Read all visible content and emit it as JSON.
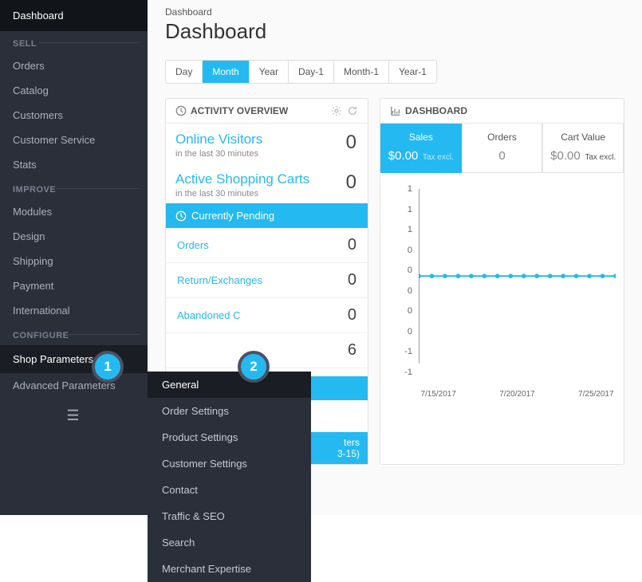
{
  "sidebar": {
    "active": "Dashboard",
    "sections": [
      {
        "label": "SELL",
        "items": [
          "Orders",
          "Catalog",
          "Customers",
          "Customer Service",
          "Stats"
        ]
      },
      {
        "label": "IMPROVE",
        "items": [
          "Modules",
          "Design",
          "Shipping",
          "Payment",
          "International"
        ]
      },
      {
        "label": "CONFIGURE",
        "items": [
          "Shop Parameters",
          "Advanced Parameters"
        ]
      }
    ]
  },
  "submenu": {
    "items": [
      "General",
      "Order Settings",
      "Product Settings",
      "Customer Settings",
      "Contact",
      "Traffic & SEO",
      "Search",
      "Merchant Expertise"
    ]
  },
  "header": {
    "breadcrumb": "Dashboard",
    "title": "Dashboard"
  },
  "time_tabs": [
    "Day",
    "Month",
    "Year",
    "Day-1",
    "Month-1",
    "Year-1"
  ],
  "time_active": "Month",
  "activity": {
    "title": "ACTIVITY OVERVIEW",
    "online_visitors": {
      "label": "Online Visitors",
      "sub": "in the last 30 minutes",
      "value": "0"
    },
    "active_carts": {
      "label": "Active Shopping Carts",
      "sub": "in the last 30 minutes",
      "value": "0"
    },
    "pending_header": "Currently Pending",
    "pending": [
      {
        "label": "Orders",
        "value": "0"
      },
      {
        "label": "Return/Exchanges",
        "value": "0"
      },
      {
        "label": "Abandoned C",
        "value": "0"
      },
      {
        "label": "",
        "value": "6"
      }
    ],
    "extra": {
      "line1": "ters",
      "line2": "3-15)"
    }
  },
  "dashboard": {
    "title": "DASHBOARD",
    "metrics": [
      {
        "name": "Sales",
        "value": "$0.00",
        "sub": "Tax excl.",
        "active": true
      },
      {
        "name": "Orders",
        "value": "0",
        "sub": "",
        "active": false
      },
      {
        "name": "Cart Value",
        "value": "$0.00",
        "sub": "Tax excl.",
        "active": false
      }
    ]
  },
  "chart_data": {
    "type": "line",
    "title": "",
    "xlabel": "",
    "ylabel": "",
    "ylim": [
      -1,
      1
    ],
    "y_ticks": [
      "1",
      "1",
      "1",
      "0",
      "0",
      "0",
      "0",
      "0",
      "-1",
      "-1"
    ],
    "x_ticks": [
      "7/15/2017",
      "7/20/2017",
      "7/25/2017"
    ],
    "series": [
      {
        "name": "Sales",
        "color": "#25b9f1",
        "x": [
          0,
          1,
          2,
          3,
          4,
          5,
          6,
          7,
          8,
          9,
          10,
          11,
          12,
          13,
          14,
          15
        ],
        "y": [
          0,
          0,
          0,
          0,
          0,
          0,
          0,
          0,
          0,
          0,
          0,
          0,
          0,
          0,
          0,
          0
        ]
      }
    ]
  },
  "badges": {
    "b1": "1",
    "b2": "2"
  }
}
